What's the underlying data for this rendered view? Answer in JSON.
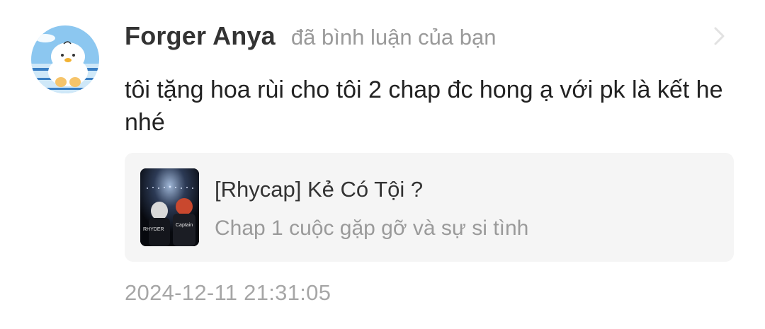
{
  "notification": {
    "username": "Forger Anya",
    "action_text": "đã bình luận của bạn",
    "comment_text": "tôi tặng hoa rùi cho tôi 2 chap đc hong ạ với pk là kết he nhé",
    "timestamp": "2024-12-11 21:31:05",
    "avatar_icon": "cartoon-chick-avatar",
    "chevron_icon": "chevron-right-icon"
  },
  "card": {
    "title": "[Rhycap] Kẻ Có Tội ?",
    "subtitle": "Chap 1 cuộc gặp gỡ và sự si tình",
    "cover_texts": [
      "RHYDER",
      "Captain"
    ]
  },
  "colors": {
    "username": "#333333",
    "secondary_text": "#9a9a9a",
    "card_background": "#f5f5f5",
    "avatar_sky": "#8cc7f0"
  }
}
